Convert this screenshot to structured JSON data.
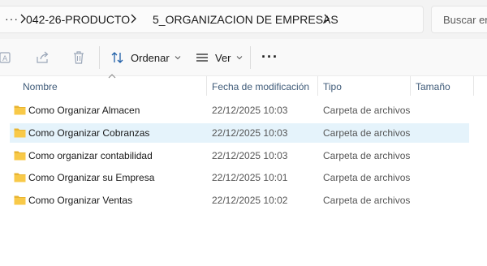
{
  "breadcrumb": {
    "more_label": "···",
    "items": [
      "042-26-PRODUCTO",
      "5_ORGANIZACION DE EMPRESAS"
    ]
  },
  "search": {
    "placeholder": "Buscar en"
  },
  "toolbar": {
    "sort_label": "Ordenar",
    "view_label": "Ver",
    "more_label": "···",
    "icons": [
      "rename-icon",
      "share-icon",
      "delete-icon",
      "sort-icon",
      "view-icon"
    ]
  },
  "columns": {
    "name": "Nombre",
    "date": "Fecha de modificación",
    "type": "Tipo",
    "size": "Tamaño"
  },
  "files": [
    {
      "name": "Como Organizar Almacen",
      "date": "22/12/2025 10:03",
      "type": "Carpeta de archivos",
      "selected": false
    },
    {
      "name": "Como Organizar Cobranzas",
      "date": "22/12/2025 10:03",
      "type": "Carpeta de archivos",
      "selected": true
    },
    {
      "name": "Como organizar contabilidad",
      "date": "22/12/2025 10:03",
      "type": "Carpeta de archivos",
      "selected": false
    },
    {
      "name": "Como Organizar su Empresa",
      "date": "22/12/2025 10:01",
      "type": "Carpeta de archivos",
      "selected": false
    },
    {
      "name": "Como Organizar Ventas",
      "date": "22/12/2025 10:02",
      "type": "Carpeta de archivos",
      "selected": false
    }
  ],
  "colors": {
    "selection": "#e5f3fb",
    "folder": "#f8c948",
    "header_text": "#3e5a78"
  }
}
